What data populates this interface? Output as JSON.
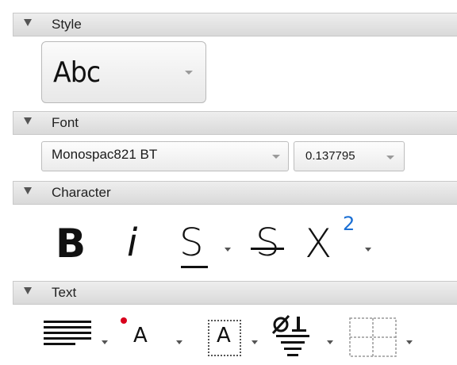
{
  "sections": [
    {
      "id": "style",
      "label": "Style"
    },
    {
      "id": "font",
      "label": "Font"
    },
    {
      "id": "character",
      "label": "Character"
    },
    {
      "id": "text",
      "label": "Text"
    }
  ],
  "style": {
    "current": "Abc"
  },
  "font": {
    "family": "Monospac821 BT",
    "size": "0.137795"
  },
  "character": {
    "bold_glyph": "B",
    "italic_glyph": "i",
    "underline_glyph": "S",
    "strike_glyph": "S",
    "superscript_base": "X",
    "superscript_exp": "2"
  },
  "text": {
    "font_color_glyph": "A",
    "highlight_glyph": "A"
  },
  "colors": {
    "header_bg": "#e3e3e3",
    "font_color_dot": "#d8001c",
    "icon": "#111111"
  }
}
